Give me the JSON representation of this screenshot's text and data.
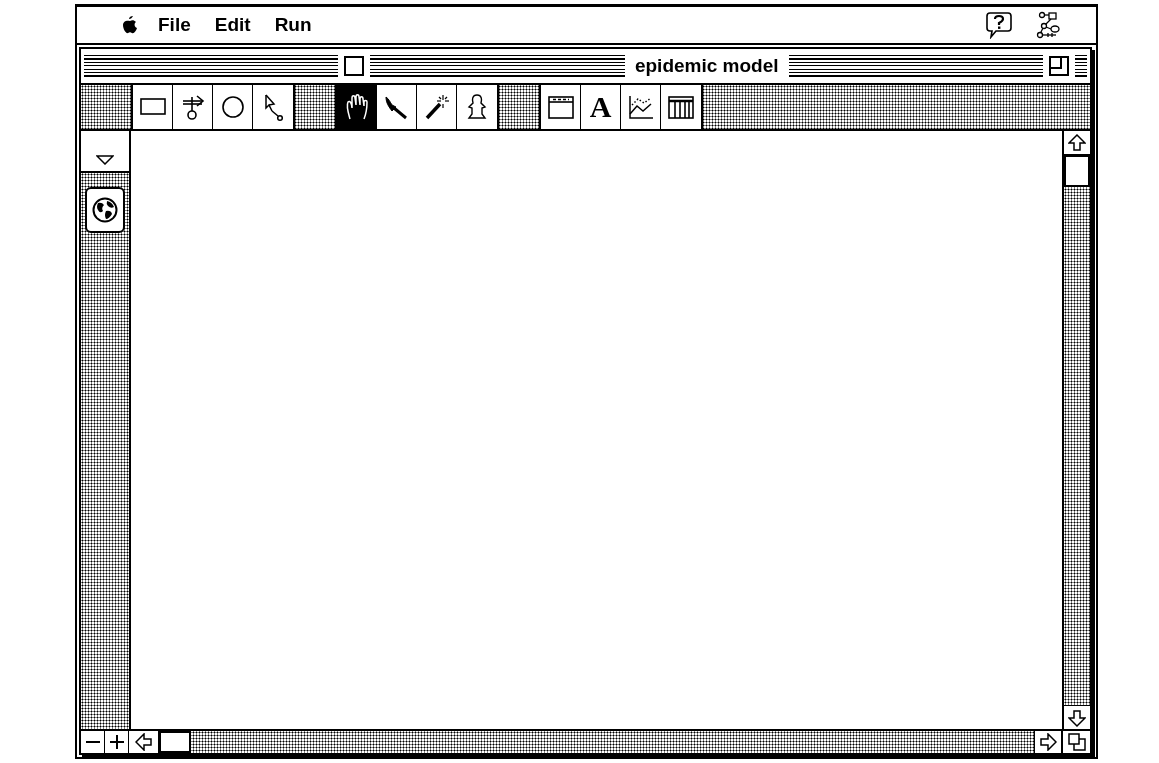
{
  "menu_bar": {
    "items": [
      "File",
      "Edit",
      "Run"
    ]
  },
  "window": {
    "title": "epidemic model"
  },
  "toolbar": {
    "groups": [
      [
        {
          "kind": "rectangle",
          "selected": false
        },
        {
          "kind": "flow",
          "selected": false
        },
        {
          "kind": "circle",
          "selected": false
        },
        {
          "kind": "connector",
          "selected": false
        }
      ],
      [
        {
          "kind": "hand",
          "selected": true
        },
        {
          "kind": "brush",
          "selected": false
        },
        {
          "kind": "wand",
          "selected": false
        },
        {
          "kind": "ghost",
          "selected": false
        }
      ],
      [
        {
          "kind": "window",
          "selected": false
        },
        {
          "kind": "text",
          "label": "A",
          "selected": false
        },
        {
          "kind": "graph",
          "selected": false
        },
        {
          "kind": "table",
          "selected": false
        }
      ]
    ]
  }
}
